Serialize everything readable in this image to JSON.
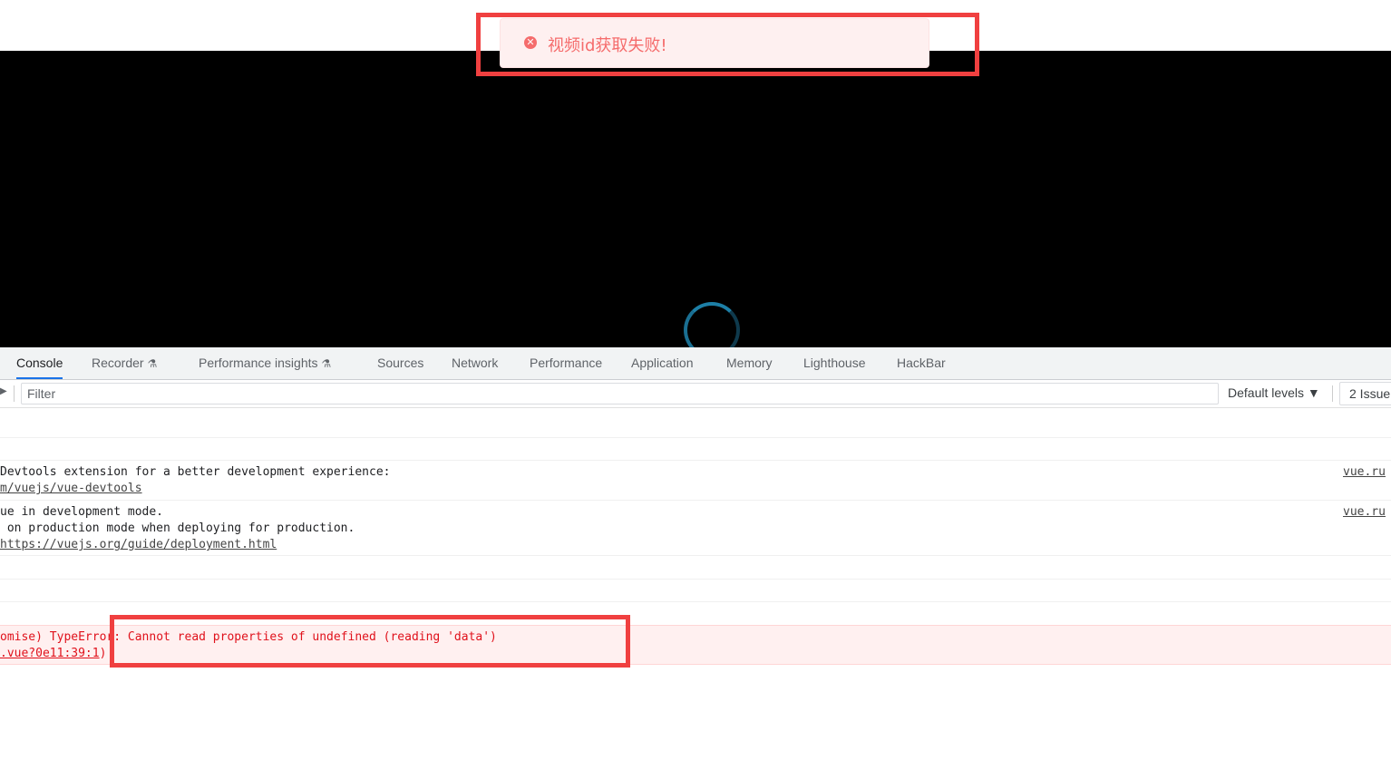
{
  "toast": {
    "icon": "error-circle-icon",
    "message": "视频id获取失败!"
  },
  "video": {
    "spinner": "loading-spinner"
  },
  "devtools": {
    "tabs": [
      {
        "label": "Console",
        "active": true
      },
      {
        "label": "Recorder",
        "flask": true
      },
      {
        "label": "Performance insights",
        "flask": true
      },
      {
        "label": "Sources"
      },
      {
        "label": "Network"
      },
      {
        "label": "Performance"
      },
      {
        "label": "Application"
      },
      {
        "label": "Memory"
      },
      {
        "label": "Lighthouse"
      },
      {
        "label": "HackBar"
      }
    ],
    "flask_glyph": "⚗",
    "filter_placeholder": "Filter",
    "levels_label": "Default levels ▼",
    "issues_label": "2 Issue"
  },
  "console": {
    "msg1": {
      "line1": "Devtools extension for a better development experience:",
      "line2": "m/vuejs/vue-devtools",
      "source": "vue.ru"
    },
    "msg2": {
      "line1": "ue in development mode.",
      "line2": " on production mode when deploying for production.",
      "line3": "https://vuejs.org/guide/deployment.html",
      "source": "vue.ru"
    },
    "error": {
      "prefix": "omise) TypeError",
      "message": ": Cannot read properties of undefined (reading 'data')",
      "location": ".vue?0e11:39:1",
      "close": ")"
    }
  }
}
